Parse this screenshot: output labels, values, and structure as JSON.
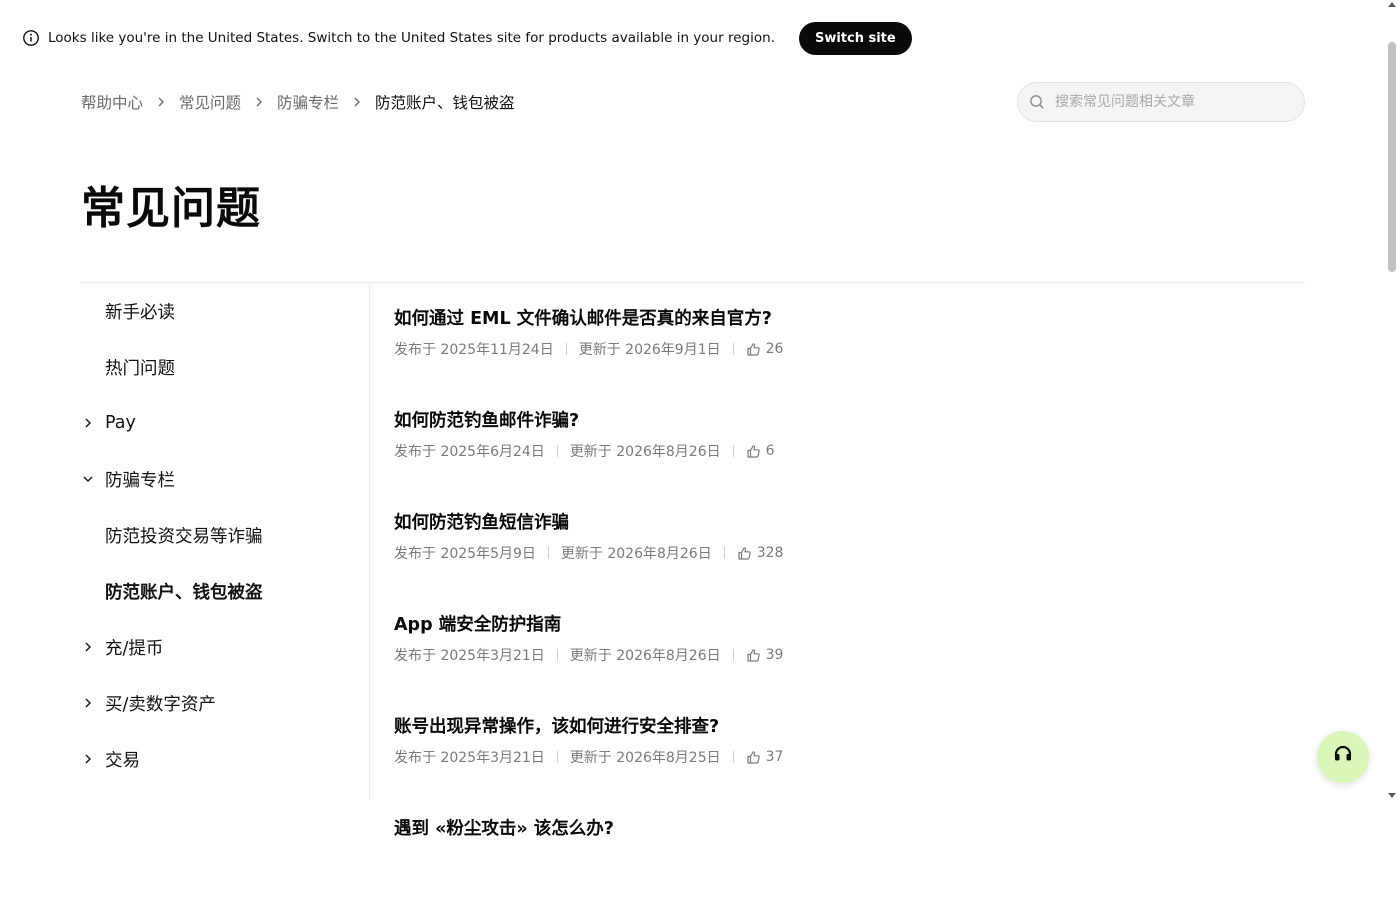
{
  "banner": {
    "message": "Looks like you're in the United States. Switch to the United States site for products available in your region.",
    "switch_label": "Switch site",
    "icon": "info-icon"
  },
  "breadcrumb": [
    "帮助中心",
    "常见问题",
    "防骗专栏",
    "防范账户、钱包被盗"
  ],
  "search": {
    "placeholder": "搜索常见问题相关文章",
    "value": "",
    "icon": "search-icon"
  },
  "page_title": "常见问题",
  "sidebar": {
    "items": [
      {
        "label": "新手必读",
        "chevron": "none",
        "indent": false,
        "active": false
      },
      {
        "label": "热门问题",
        "chevron": "none",
        "indent": false,
        "active": false
      },
      {
        "label": "Pay",
        "chevron": "right",
        "indent": false,
        "active": false
      },
      {
        "label": "防骗专栏",
        "chevron": "down",
        "indent": false,
        "active": false
      },
      {
        "label": "防范投资交易等诈骗",
        "chevron": "none",
        "indent": true,
        "active": false
      },
      {
        "label": "防范账户、钱包被盗",
        "chevron": "none",
        "indent": true,
        "active": true
      },
      {
        "label": "充/提币",
        "chevron": "right",
        "indent": false,
        "active": false
      },
      {
        "label": "买/卖数字资产",
        "chevron": "right",
        "indent": false,
        "active": false
      },
      {
        "label": "交易",
        "chevron": "right",
        "indent": false,
        "active": false
      }
    ]
  },
  "articles": [
    {
      "title": "如何通过 EML 文件确认邮件是否真的来自官方?",
      "published": "发布于 2025年11月24日",
      "updated": "更新于 2026年9月1日",
      "likes": "26"
    },
    {
      "title": "如何防范钓鱼邮件诈骗?",
      "published": "发布于 2025年6月24日",
      "updated": "更新于 2026年8月26日",
      "likes": "6"
    },
    {
      "title": "如何防范钓鱼短信诈骗",
      "published": "发布于 2025年5月9日",
      "updated": "更新于 2026年8月26日",
      "likes": "328"
    },
    {
      "title": "App 端安全防护指南",
      "published": "发布于 2025年3月21日",
      "updated": "更新于 2026年8月26日",
      "likes": "39"
    },
    {
      "title": "账号出现异常操作，该如何进行安全排查?",
      "published": "发布于 2025年3月21日",
      "updated": "更新于 2026年8月25日",
      "likes": "37"
    },
    {
      "title": "遇到 «粉尘攻击» 该怎么办?",
      "published": "",
      "updated": "",
      "likes": ""
    }
  ],
  "support": {
    "icon": "headset-icon",
    "color": "#d9f7b8"
  },
  "colors": {
    "accent_dark": "#0a0a0a",
    "muted": "#7a7a7a",
    "support_bg": "#d9f7b8"
  }
}
